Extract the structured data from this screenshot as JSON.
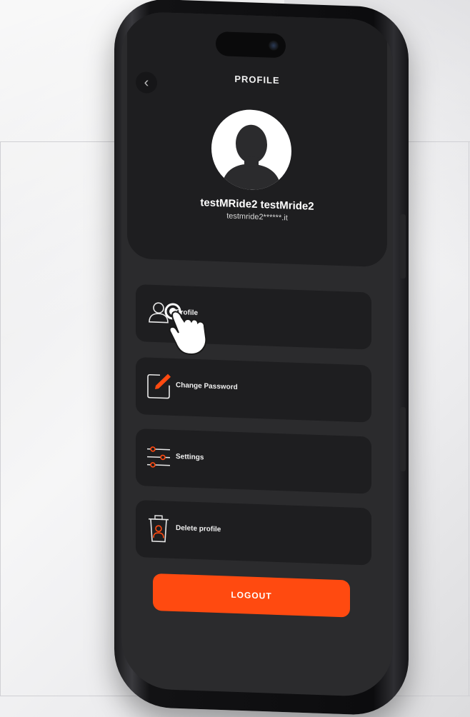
{
  "header": {
    "title": "PROFILE",
    "back_icon": "chevron-left-icon",
    "user_name": "testMRide2 testMride2",
    "user_email": "testmride2******.it"
  },
  "menu": {
    "items": [
      {
        "label": "Profile",
        "icon": "user-icon"
      },
      {
        "label": "Change Password",
        "icon": "edit-icon"
      },
      {
        "label": "Settings",
        "icon": "sliders-icon"
      },
      {
        "label": "Delete profile",
        "icon": "trash-icon"
      }
    ]
  },
  "logout": {
    "label": "LOGOUT"
  },
  "colors": {
    "accent": "#ff4a10",
    "card": "#1e1e20",
    "screen": "#2b2b2d",
    "text": "#ffffff"
  }
}
